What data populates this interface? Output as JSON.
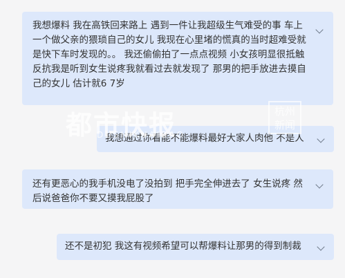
{
  "messages": [
    {
      "text": "我想爆料 我在高铁回来路上 遇到一件让我超级生气难受的事 车上一个做父亲的猥琐自己的女儿 我现在心里堵的慌真的当时超难受就是快下车时发现的。。 我还偷偷拍了一点点视频 小女孩明显很抵触反抗我是听到女生说疼我就看过去就发现了 那男的把手放进去摸自己的女儿 估计就6 7岁"
    },
    {
      "text": "我想通过你看能不能爆料最好大家人肉他 不是人"
    },
    {
      "text": "还有更恶心的我手机没电了没拍到 把手完全伸进去了 女生说疼 然后说爸爸你不要又摸我屁股了"
    },
    {
      "text": "还不是初犯 我这有视频希望可以帮爆料让那男的得到制裁"
    }
  ],
  "watermark": {
    "brand": "都市快报",
    "latin": "DUSHIKUAIBAO",
    "logo": "杭州新闻"
  }
}
